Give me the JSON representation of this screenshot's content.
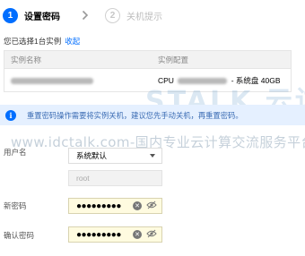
{
  "steps": [
    {
      "number": "1",
      "label": "设置密码",
      "state": "active"
    },
    {
      "number": "2",
      "label": "关机提示",
      "state": "inactive"
    }
  ],
  "selection": {
    "text": "您已选择1台实例",
    "collapse_link": "收起"
  },
  "table": {
    "headers": [
      "实例名称",
      "实例配置"
    ],
    "rows": [
      {
        "name": "",
        "config_prefix": "CPU",
        "config_disk": "- 系统盘 40GB"
      }
    ]
  },
  "alert": {
    "icon": "info-icon",
    "text": "重置密码操作需要将实例关机，建议您先手动关机，再重置密码。"
  },
  "watermark": {
    "logo": "STALK 云访",
    "url": "www.idctalk.com-国内专业云计算交流服务平台"
  },
  "form": {
    "username": {
      "label": "用户名",
      "value": "系统默认",
      "readonly_value": "root"
    },
    "new_password": {
      "label": "新密码",
      "masked_value": "●●●●●●●●●"
    },
    "confirm_password": {
      "label": "确认密码",
      "masked_value": "●●●●●●●●●"
    }
  },
  "colors": {
    "primary": "#006eff",
    "alert_bg": "#e5f0ff",
    "autofill_bg": "#fffbe0"
  }
}
